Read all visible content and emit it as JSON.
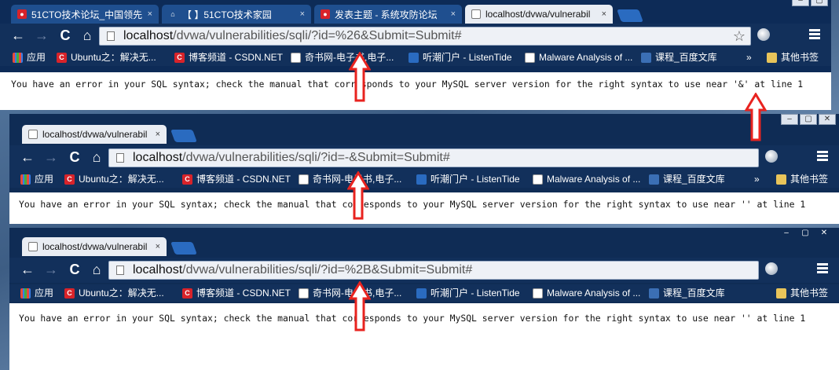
{
  "windows": [
    {
      "tabs": [
        {
          "label": "51CTO技术论坛_中国领先"
        },
        {
          "label": "【 】51CTO技术家园"
        },
        {
          "label": "发表主题 - 系统攻防论坛"
        },
        {
          "label": "localhost/dvwa/vulnerabil"
        }
      ],
      "url_host": "localhost",
      "url_path": "/dvwa/vulnerabilities/sqli/?id=%26&Submit=Submit#",
      "message": "You have an error in your SQL syntax; check the manual that corresponds to your MySQL server version for the right syntax to use near '&' at line 1"
    },
    {
      "tabs": [
        {
          "label": "localhost/dvwa/vulnerabil"
        }
      ],
      "url_host": "localhost",
      "url_path": "/dvwa/vulnerabilities/sqli/?id=-&Submit=Submit#",
      "message": "You have an error in your SQL syntax; check the manual that corresponds to your MySQL server version for the right syntax to use near '' at line 1"
    },
    {
      "tabs": [
        {
          "label": "localhost/dvwa/vulnerabil"
        }
      ],
      "url_host": "localhost",
      "url_path": "/dvwa/vulnerabilities/sqli/?id=%2B&Submit=Submit#",
      "message": "You have an error in your SQL syntax; check the manual that corresponds to your MySQL server version for the right syntax to use near '' at line 1"
    }
  ],
  "bookmarks": [
    {
      "label": "应用",
      "icon": "apps-icon"
    },
    {
      "label": "Ubuntu之：解决无...",
      "icon": "csdn-icon"
    },
    {
      "label": "博客频道 - CSDN.NET",
      "icon": "csdn-icon"
    },
    {
      "label": "奇书网-电子书,电子...",
      "icon": "page-icon"
    },
    {
      "label": "听潮门户 - ListenTide",
      "icon": "globe-icon"
    },
    {
      "label": "Malware Analysis of ...",
      "icon": "page-icon"
    },
    {
      "label": "课程_百度文库",
      "icon": "image-icon"
    }
  ],
  "bookmarks_overflow": "»",
  "other_bookmarks": "其他书签",
  "nav": {
    "back": "←",
    "forward": "→",
    "reload": "C",
    "home": "⌂"
  },
  "colors": {
    "arrow": "#e8231f",
    "frame": "#0d2b57",
    "tab_active": "#e9edf3"
  }
}
